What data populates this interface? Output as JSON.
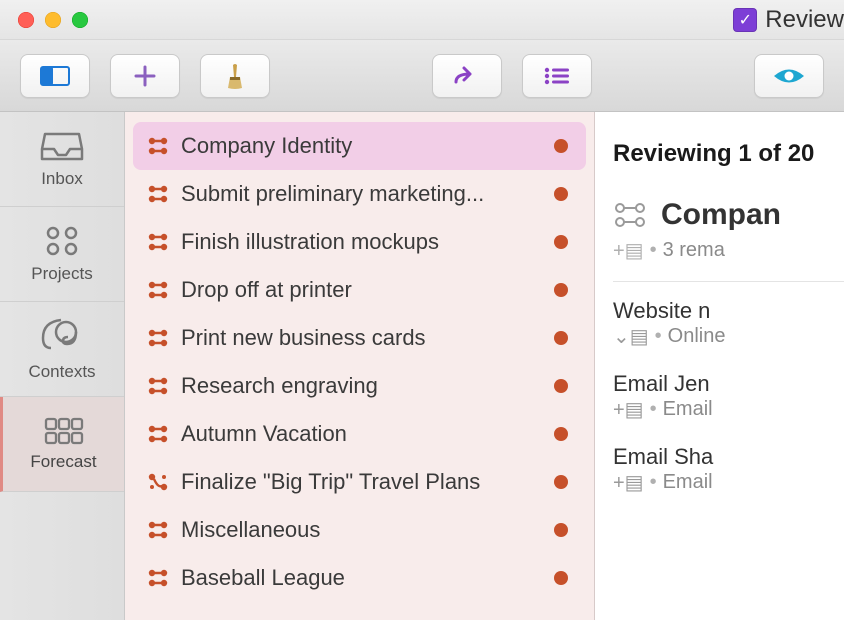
{
  "window": {
    "title": "Review"
  },
  "toolbar": {
    "buttons": [
      "sidebar-toggle",
      "add",
      "brush",
      "review",
      "list",
      "view"
    ]
  },
  "sidebar": {
    "items": [
      {
        "id": "inbox",
        "label": "Inbox"
      },
      {
        "id": "projects",
        "label": "Projects"
      },
      {
        "id": "contexts",
        "label": "Contexts"
      },
      {
        "id": "forecast",
        "label": "Forecast"
      }
    ]
  },
  "projects": [
    {
      "name": "Company Identity",
      "kind": "parallel",
      "selected": true
    },
    {
      "name": "Submit preliminary marketing...",
      "kind": "parallel",
      "selected": false
    },
    {
      "name": "Finish illustration mockups",
      "kind": "parallel",
      "selected": false
    },
    {
      "name": "Drop off at printer",
      "kind": "parallel",
      "selected": false
    },
    {
      "name": "Print new business cards",
      "kind": "parallel",
      "selected": false
    },
    {
      "name": "Research engraving",
      "kind": "parallel",
      "selected": false
    },
    {
      "name": "Autumn Vacation",
      "kind": "parallel",
      "selected": false
    },
    {
      "name": "Finalize \"Big Trip\" Travel Plans",
      "kind": "sequential",
      "selected": false
    },
    {
      "name": "Miscellaneous",
      "kind": "parallel",
      "selected": false
    },
    {
      "name": "Baseball League",
      "kind": "parallel",
      "selected": false
    }
  ],
  "inspector": {
    "heading": "Reviewing 1 of 20",
    "project_title": "Compan",
    "remaining_line": "3 rema",
    "tasks": [
      {
        "title": "Website n",
        "disclosure": "expanded",
        "context": "Online"
      },
      {
        "title": "Email Jen",
        "disclosure": "collapsed",
        "context": "Email"
      },
      {
        "title": "Email Sha",
        "disclosure": "collapsed",
        "context": "Email"
      }
    ]
  },
  "colors": {
    "brand_purple": "#7d3ed6",
    "accent_red": "#c6502a",
    "selection_bg": "#f2cee7",
    "pane_bg": "#f8eceb"
  }
}
